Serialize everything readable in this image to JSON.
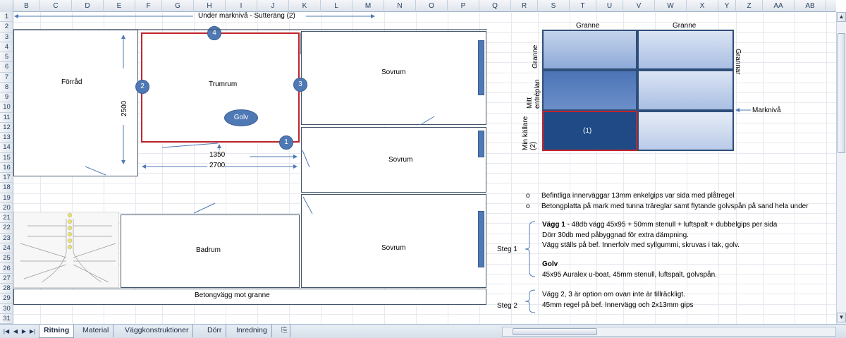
{
  "columns": [
    "B",
    "C",
    "D",
    "E",
    "F",
    "G",
    "H",
    "I",
    "J",
    "K",
    "L",
    "M",
    "N",
    "O",
    "P",
    "Q",
    "R",
    "S",
    "T",
    "U",
    "V",
    "W",
    "X",
    "Y",
    "Z",
    "AA",
    "AB"
  ],
  "rows": [
    "1",
    "2",
    "3",
    "4",
    "5",
    "6",
    "7",
    "8",
    "9",
    "10",
    "11",
    "12",
    "13",
    "14",
    "15",
    "16",
    "17",
    "18",
    "19",
    "20",
    "21",
    "22",
    "23",
    "24",
    "25",
    "26",
    "27",
    "28",
    "29",
    "30",
    "31"
  ],
  "plan": {
    "title": "Under marknivå - Sutteräng (2)",
    "rooms": {
      "forrad": "Förråd",
      "trumrum": "Trumrum",
      "sovrum1": "Sovrum",
      "sovrum2": "Sovrum",
      "sovrum3": "Sovrum",
      "badrum": "Badrum",
      "betongvagg": "Betongvägg mot granne"
    },
    "dims": {
      "height": "2500",
      "width_half": "1350",
      "width_full": "2700"
    },
    "markers": {
      "m1": "1",
      "m2": "2",
      "m3": "3",
      "m4": "4",
      "golv": "Golv"
    }
  },
  "diagram": {
    "top_label_1": "Granne",
    "top_label_2": "Granne",
    "right_label": "Grannar",
    "left_top": "Granne",
    "left_mid": "Mitt entréplan",
    "left_bot": "Min källare (2)",
    "cell_label": "(1)",
    "marker_label": "Marknivå"
  },
  "notes": {
    "bullets": [
      "Befintliga innerväggar 13mm enkelgips var sida med plåtregel",
      "Betongplatta på mark med tunna träreglar samt flytande golvspån på sand hela under"
    ],
    "steg1_label": "Steg 1",
    "steg1_bold": "Vägg 1",
    "steg1_line1": " - 48db vägg 45x95 + 50mm stenull + luftspalt + dubbelgips per sida",
    "steg1_line2": "Dörr 30db med påbyggnad för extra dämpning.",
    "steg1_line3": "Vägg ställs på bef. Innerfolv med syllgummi, skruvas i tak, golv.",
    "golv_title": "Golv",
    "golv_line": "45x95 Auralex u-boat, 45mm stenull, luftspalt, golvspån.",
    "steg2_label": "Steg 2",
    "steg2_line1": "Vägg 2, 3 är option om ovan inte är tillräckligt.",
    "steg2_line2": "45mm regel på bef. Innervägg och 2x13mm gips"
  },
  "tabs": [
    "Ritning",
    "Material",
    "Väggkonstruktioner",
    "Dörr",
    "Inredning"
  ]
}
